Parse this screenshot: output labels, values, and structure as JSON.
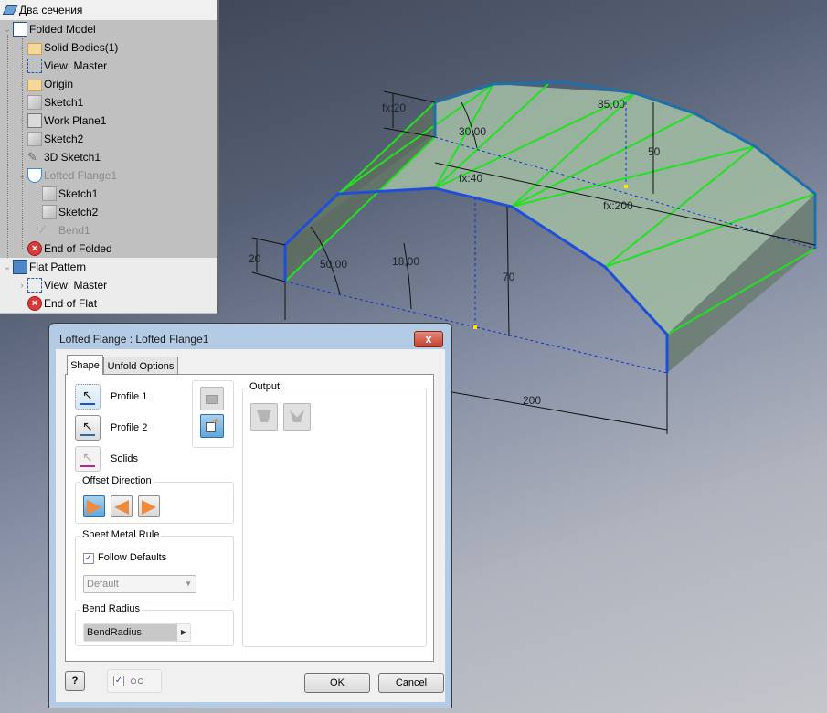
{
  "browser": {
    "title": "Два сечения",
    "items": [
      {
        "label": "Folded Model",
        "expander": "expanded",
        "icon": "folded-model-icon"
      },
      {
        "label": "Solid Bodies(1)",
        "expander": "collapsed",
        "icon": "solid-bodies-folder-icon"
      },
      {
        "label": "View: Master",
        "expander": "collapsed",
        "icon": "view-icon"
      },
      {
        "label": "Origin",
        "expander": "collapsed",
        "icon": "folder-icon"
      },
      {
        "label": "Sketch1",
        "expander": "none",
        "icon": "sketch-icon"
      },
      {
        "label": "Work Plane1",
        "expander": "collapsed",
        "icon": "work-plane-icon"
      },
      {
        "label": "Sketch2",
        "expander": "none",
        "icon": "sketch-icon"
      },
      {
        "label": "3D Sketch1",
        "expander": "none",
        "icon": "3d-sketch-icon"
      },
      {
        "label": "Lofted Flange1",
        "expander": "expanded",
        "icon": "lofted-flange-icon",
        "state": "dimmed"
      },
      {
        "label": "Sketch1",
        "expander": "none",
        "icon": "sketch-icon"
      },
      {
        "label": "Sketch2",
        "expander": "none",
        "icon": "sketch-icon"
      },
      {
        "label": "Bend1",
        "expander": "none",
        "icon": "bend-icon",
        "state": "dimmed"
      },
      {
        "label": "End of Folded",
        "expander": "none",
        "icon": "end-of-part-icon"
      },
      {
        "label": "Flat Pattern",
        "expander": "expanded",
        "icon": "flat-pattern-icon"
      },
      {
        "label": "View: Master",
        "expander": "collapsed",
        "icon": "view-icon"
      },
      {
        "label": "End of Flat",
        "expander": "none",
        "icon": "end-of-part-icon"
      }
    ]
  },
  "viewport": {
    "dimensions": {
      "fx20": "fx:20",
      "a30": "30,00",
      "a85": "85,00",
      "d50": "50",
      "fx40": "fx:40",
      "fx200": "fx:200",
      "d20": "20",
      "a50": "50,00",
      "a18": "18,00",
      "d70": "70",
      "d200": "200"
    },
    "colors": {
      "profile_edge": "#1f4fd8",
      "loft_lines": "#22e022",
      "surface": "#9eb8a2",
      "sketch_dashed": "#1030d0",
      "point": "#ffe400"
    }
  },
  "dialog": {
    "title": "Lofted Flange : Lofted Flange1",
    "close_label": "x",
    "tabs": [
      {
        "label": "Shape",
        "active": true
      },
      {
        "label": "Unfold Options",
        "active": false
      }
    ],
    "profile1_label": "Profile 1",
    "profile2_label": "Profile 2",
    "solids_label": "Solids",
    "offset_direction_label": "Offset Direction",
    "sheet_metal_rule_label": "Sheet Metal Rule",
    "follow_defaults_label": "Follow Defaults",
    "follow_defaults_checked": true,
    "rule_value": "Default",
    "bend_radius_label": "Bend Radius",
    "bend_radius_value": "BendRadius",
    "output_label": "Output",
    "preview_checked": true,
    "ok_label": "OK",
    "cancel_label": "Cancel",
    "help_label": "?"
  }
}
